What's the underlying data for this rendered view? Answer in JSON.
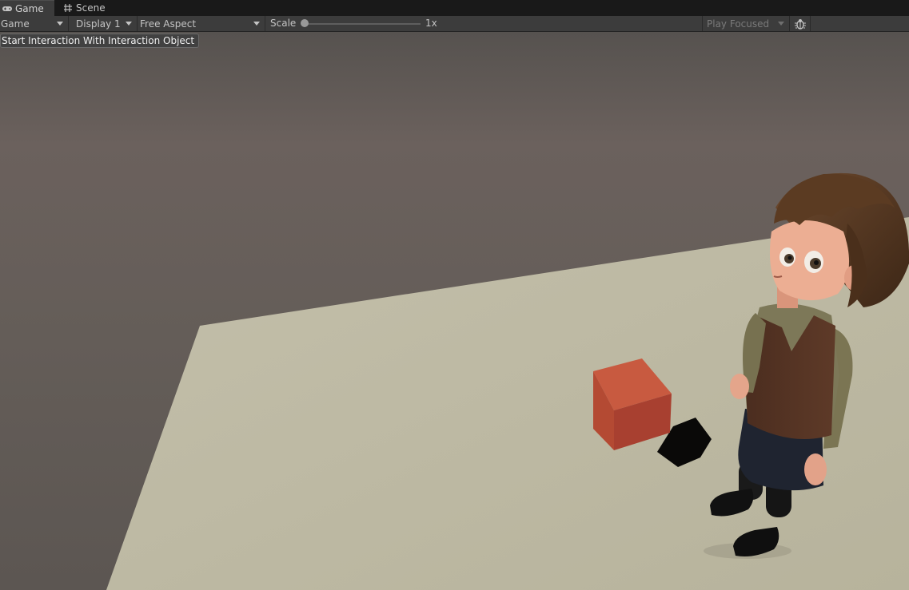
{
  "tabs": [
    {
      "label": "Game",
      "icon": "gamepad-icon",
      "active": true
    },
    {
      "label": "Scene",
      "icon": "grid-hash-icon",
      "active": false
    }
  ],
  "toolbar": {
    "view_mode": "Game",
    "display": "Display 1",
    "aspect": "Free Aspect",
    "scale_label": "Scale",
    "scale_value": "1x",
    "play_mode": "Play Focused",
    "debug_icon": "bug-icon"
  },
  "game_ui": {
    "interaction_button": "Start Interaction With Interaction Object"
  },
  "scene": {
    "sky_color": "#5f5955",
    "floor_color": "#bcb8a1",
    "cube_color": "#c0533a"
  }
}
